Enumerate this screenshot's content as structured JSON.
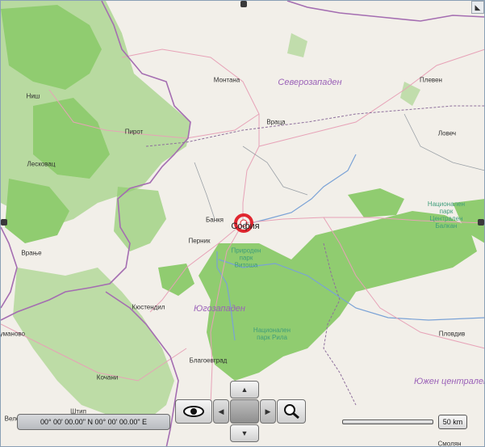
{
  "map": {
    "cities": [
      {
        "name": "Монтана"
      },
      {
        "name": "Ниш"
      },
      {
        "name": "Пирот"
      },
      {
        "name": "Враца"
      },
      {
        "name": "Плевен"
      },
      {
        "name": "Ловеч"
      },
      {
        "name": "Лесковац"
      },
      {
        "name": "Банкя"
      },
      {
        "name": "София"
      },
      {
        "name": "Перник"
      },
      {
        "name": "Врање"
      },
      {
        "name": "Кюстендил"
      },
      {
        "name": "Благоевград"
      },
      {
        "name": "Пловдив"
      },
      {
        "name": "Кочани"
      },
      {
        "name": "Штип"
      },
      {
        "name": "Велес"
      },
      {
        "name": "Смолян"
      },
      {
        "name": "Куманово"
      }
    ],
    "regions": [
      {
        "name": "Северозападен"
      },
      {
        "name": "Югозападен"
      },
      {
        "name": "Южен централен"
      }
    ],
    "parks": [
      {
        "name": "Природен парк Витоша"
      },
      {
        "name": "Национален парк Рила"
      },
      {
        "name": "Национален парк Централен Балкан"
      }
    ],
    "marker_icon": "location-target-icon",
    "colors": {
      "background": "#f2efe9",
      "forest": "#7fc65a",
      "border_purple": "#a46db1",
      "road_pink": "#e7a2b7",
      "river_blue": "#7aa2d6",
      "marker_red": "#e0262f"
    }
  },
  "controls": {
    "coordinates": "00° 00' 00.00\" N 00° 00' 00.00\" E",
    "scale_label": "50 km",
    "view_icon": "eye-icon",
    "search_icon": "magnifier-icon",
    "pan_up_icon": "arrow-up-icon",
    "pan_down_icon": "arrow-down-icon",
    "pan_left_icon": "arrow-left-icon",
    "pan_right_icon": "arrow-right-icon",
    "corner_icon": "expand-corner-icon"
  }
}
